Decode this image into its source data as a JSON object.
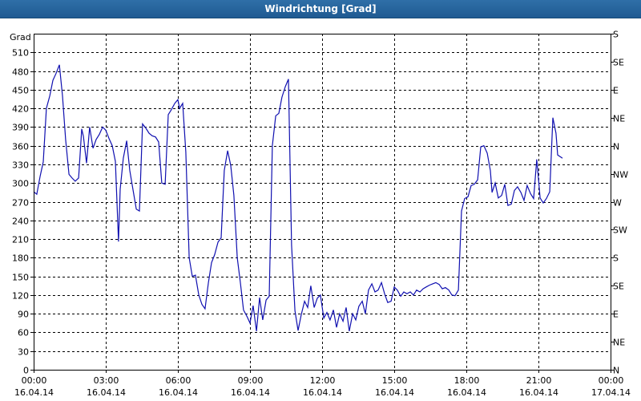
{
  "window": {
    "title": "Windrichtung [Grad]"
  },
  "chart_data": {
    "type": "line",
    "title": "Windrichtung [Grad]",
    "ylabel": "Grad",
    "xlabel": "",
    "ylim": [
      0,
      540
    ],
    "y_ticks": [
      0,
      30,
      60,
      90,
      120,
      150,
      180,
      210,
      240,
      270,
      300,
      330,
      360,
      390,
      420,
      450,
      480,
      510
    ],
    "x_range_hours": [
      0,
      24
    ],
    "x_ticks": [
      {
        "hour": 0,
        "time": "00:00",
        "date": "16.04.14"
      },
      {
        "hour": 3,
        "time": "03:00",
        "date": "16.04.14"
      },
      {
        "hour": 6,
        "time": "06:00",
        "date": "16.04.14"
      },
      {
        "hour": 9,
        "time": "09:00",
        "date": "16.04.14"
      },
      {
        "hour": 12,
        "time": "12:00",
        "date": "16.04.14"
      },
      {
        "hour": 15,
        "time": "15:00",
        "date": "16.04.14"
      },
      {
        "hour": 18,
        "time": "18:00",
        "date": "16.04.14"
      },
      {
        "hour": 21,
        "time": "21:00",
        "date": "16.04.14"
      },
      {
        "hour": 24,
        "time": "00:00",
        "date": "17.04.14"
      }
    ],
    "right_axis": [
      {
        "value": 0,
        "label": "N"
      },
      {
        "value": 45,
        "label": "NE"
      },
      {
        "value": 90,
        "label": "E"
      },
      {
        "value": 135,
        "label": "SE"
      },
      {
        "value": 180,
        "label": "S"
      },
      {
        "value": 225,
        "label": "SW"
      },
      {
        "value": 270,
        "label": "W"
      },
      {
        "value": 315,
        "label": "NW"
      },
      {
        "value": 360,
        "label": "N"
      },
      {
        "value": 405,
        "label": "NE"
      },
      {
        "value": 450,
        "label": "E"
      },
      {
        "value": 495,
        "label": "SE"
      },
      {
        "value": 540,
        "label": "S"
      }
    ],
    "grid": true,
    "series": [
      {
        "color": "#1010b0",
        "points": [
          [
            0.0,
            286
          ],
          [
            0.13,
            282
          ],
          [
            0.27,
            311
          ],
          [
            0.4,
            334
          ],
          [
            0.53,
            420
          ],
          [
            0.67,
            440
          ],
          [
            0.8,
            465
          ],
          [
            0.93,
            476
          ],
          [
            1.07,
            490
          ],
          [
            1.2,
            440
          ],
          [
            1.33,
            370
          ],
          [
            1.47,
            314
          ],
          [
            1.6,
            308
          ],
          [
            1.73,
            303
          ],
          [
            1.87,
            308
          ],
          [
            2.0,
            387
          ],
          [
            2.07,
            375
          ],
          [
            2.2,
            332
          ],
          [
            2.33,
            390
          ],
          [
            2.47,
            356
          ],
          [
            2.6,
            370
          ],
          [
            2.73,
            378
          ],
          [
            2.87,
            390
          ],
          [
            3.0,
            385
          ],
          [
            3.13,
            372
          ],
          [
            3.27,
            360
          ],
          [
            3.4,
            335
          ],
          [
            3.53,
            206
          ],
          [
            3.6,
            290
          ],
          [
            3.73,
            340
          ],
          [
            3.87,
            368
          ],
          [
            4.0,
            320
          ],
          [
            4.13,
            290
          ],
          [
            4.27,
            258
          ],
          [
            4.4,
            255
          ],
          [
            4.53,
            395
          ],
          [
            4.67,
            388
          ],
          [
            4.8,
            380
          ],
          [
            4.93,
            376
          ],
          [
            5.07,
            374
          ],
          [
            5.2,
            366
          ],
          [
            5.33,
            300
          ],
          [
            5.47,
            298
          ],
          [
            5.6,
            410
          ],
          [
            5.73,
            418
          ],
          [
            5.87,
            428
          ],
          [
            6.0,
            434
          ],
          [
            6.07,
            420
          ],
          [
            6.2,
            428
          ],
          [
            6.33,
            350
          ],
          [
            6.47,
            180
          ],
          [
            6.6,
            150
          ],
          [
            6.73,
            152
          ],
          [
            6.87,
            120
          ],
          [
            7.0,
            105
          ],
          [
            7.13,
            98
          ],
          [
            7.27,
            140
          ],
          [
            7.4,
            172
          ],
          [
            7.53,
            185
          ],
          [
            7.67,
            205
          ],
          [
            7.8,
            212
          ],
          [
            7.93,
            320
          ],
          [
            8.07,
            352
          ],
          [
            8.2,
            328
          ],
          [
            8.33,
            280
          ],
          [
            8.47,
            180
          ],
          [
            8.6,
            140
          ],
          [
            8.73,
            96
          ],
          [
            8.87,
            86
          ],
          [
            9.0,
            75
          ],
          [
            9.13,
            103
          ],
          [
            9.27,
            62
          ],
          [
            9.4,
            116
          ],
          [
            9.53,
            80
          ],
          [
            9.67,
            112
          ],
          [
            9.8,
            118
          ],
          [
            9.93,
            360
          ],
          [
            10.07,
            408
          ],
          [
            10.2,
            412
          ],
          [
            10.33,
            438
          ],
          [
            10.47,
            455
          ],
          [
            10.6,
            467
          ],
          [
            10.73,
            200
          ],
          [
            10.87,
            95
          ],
          [
            11.0,
            63
          ],
          [
            11.13,
            88
          ],
          [
            11.27,
            110
          ],
          [
            11.4,
            100
          ],
          [
            11.53,
            135
          ],
          [
            11.67,
            100
          ],
          [
            11.8,
            115
          ],
          [
            11.93,
            120
          ],
          [
            12.07,
            83
          ],
          [
            12.2,
            92
          ],
          [
            12.33,
            80
          ],
          [
            12.47,
            96
          ],
          [
            12.6,
            68
          ],
          [
            12.73,
            90
          ],
          [
            12.87,
            78
          ],
          [
            13.0,
            100
          ],
          [
            13.13,
            62
          ],
          [
            13.27,
            90
          ],
          [
            13.4,
            80
          ],
          [
            13.53,
            102
          ],
          [
            13.67,
            110
          ],
          [
            13.8,
            90
          ],
          [
            13.93,
            128
          ],
          [
            14.07,
            138
          ],
          [
            14.2,
            125
          ],
          [
            14.33,
            128
          ],
          [
            14.47,
            140
          ],
          [
            14.6,
            122
          ],
          [
            14.73,
            108
          ],
          [
            14.87,
            110
          ],
          [
            15.0,
            133
          ],
          [
            15.13,
            128
          ],
          [
            15.27,
            118
          ],
          [
            15.4,
            125
          ],
          [
            15.53,
            122
          ],
          [
            15.67,
            125
          ],
          [
            15.8,
            120
          ],
          [
            15.93,
            128
          ],
          [
            16.07,
            125
          ],
          [
            16.2,
            130
          ],
          [
            16.33,
            133
          ],
          [
            16.47,
            136
          ],
          [
            16.6,
            138
          ],
          [
            16.73,
            140
          ],
          [
            16.87,
            137
          ],
          [
            17.0,
            130
          ],
          [
            17.13,
            132
          ],
          [
            17.27,
            128
          ],
          [
            17.4,
            120
          ],
          [
            17.53,
            119
          ],
          [
            17.67,
            128
          ],
          [
            17.8,
            255
          ],
          [
            17.93,
            275
          ],
          [
            18.07,
            278
          ],
          [
            18.2,
            296
          ],
          [
            18.33,
            298
          ],
          [
            18.47,
            305
          ],
          [
            18.6,
            358
          ],
          [
            18.73,
            360
          ],
          [
            18.87,
            348
          ],
          [
            19.0,
            320
          ],
          [
            19.07,
            285
          ],
          [
            19.2,
            300
          ],
          [
            19.33,
            276
          ],
          [
            19.47,
            280
          ],
          [
            19.6,
            298
          ],
          [
            19.73,
            264
          ],
          [
            19.87,
            266
          ],
          [
            20.0,
            288
          ],
          [
            20.13,
            294
          ],
          [
            20.27,
            285
          ],
          [
            20.4,
            272
          ],
          [
            20.53,
            296
          ],
          [
            20.67,
            283
          ],
          [
            20.8,
            275
          ],
          [
            20.93,
            338
          ],
          [
            21.07,
            276
          ],
          [
            21.2,
            268
          ],
          [
            21.33,
            275
          ],
          [
            21.47,
            286
          ],
          [
            21.6,
            405
          ],
          [
            21.73,
            380
          ],
          [
            21.8,
            345
          ],
          [
            22.0,
            340
          ]
        ]
      }
    ]
  }
}
